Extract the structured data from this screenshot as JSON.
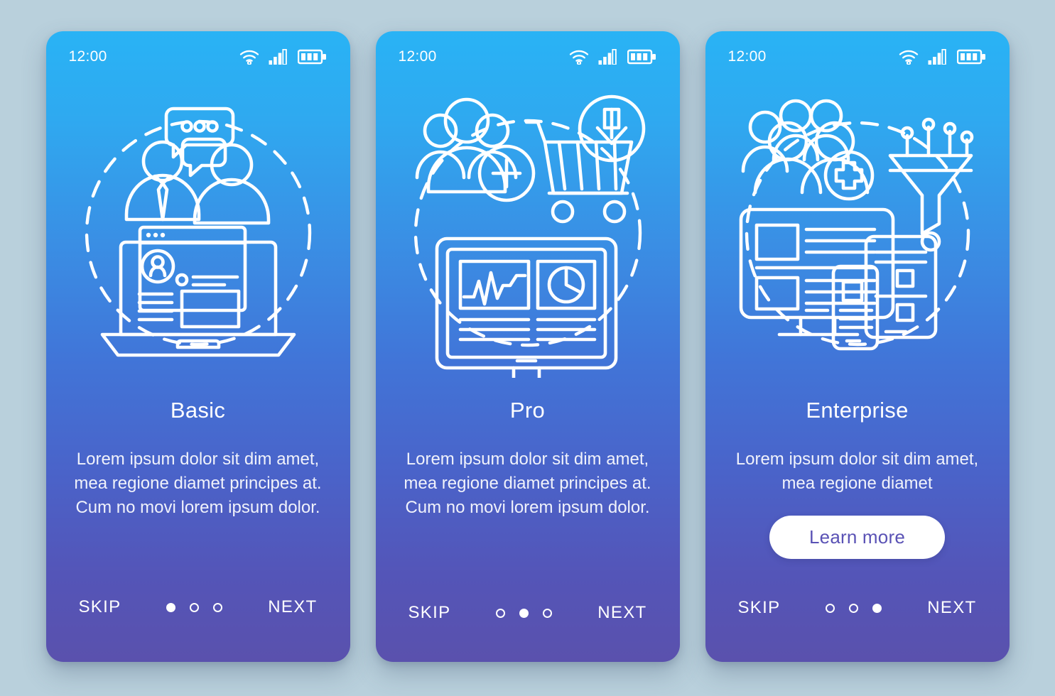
{
  "page": {
    "background_color": "#b9d0dc",
    "gradient_top": "#29b3f5",
    "gradient_bottom": "#5a51ad",
    "accent_button_text_color": "#5a52b5"
  },
  "screens": [
    {
      "id": "basic",
      "status_bar": {
        "time": "12:00",
        "icons": [
          "wifi-icon",
          "signal-icon",
          "battery-icon"
        ]
      },
      "illustration": "team-chat-laptop-illustration",
      "title": "Basic",
      "description": "Lorem ipsum dolor sit dim amet, mea regione diamet principes at. Cum no movi lorem ipsum dolor.",
      "cta": null,
      "nav": {
        "skip_label": "SKIP",
        "next_label": "NEXT",
        "dots_total": 3,
        "dot_active_index": 0
      }
    },
    {
      "id": "pro",
      "status_bar": {
        "time": "12:00",
        "icons": [
          "wifi-icon",
          "signal-icon",
          "battery-icon"
        ]
      },
      "illustration": "users-cart-analytics-monitor-illustration",
      "title": "Pro",
      "description": "Lorem ipsum dolor sit dim amet, mea regione diamet principes at. Cum no movi lorem ipsum dolor.",
      "cta": null,
      "nav": {
        "skip_label": "SKIP",
        "next_label": "NEXT",
        "dots_total": 3,
        "dot_active_index": 1
      }
    },
    {
      "id": "enterprise",
      "status_bar": {
        "time": "12:00",
        "icons": [
          "wifi-icon",
          "signal-icon",
          "battery-icon"
        ]
      },
      "illustration": "users-funnel-responsive-devices-illustration",
      "title": "Enterprise",
      "description": "Lorem ipsum dolor sit dim amet, mea regione diamet",
      "cta": {
        "label": "Learn more"
      },
      "nav": {
        "skip_label": "SKIP",
        "next_label": "NEXT",
        "dots_total": 3,
        "dot_active_index": 2
      }
    }
  ]
}
